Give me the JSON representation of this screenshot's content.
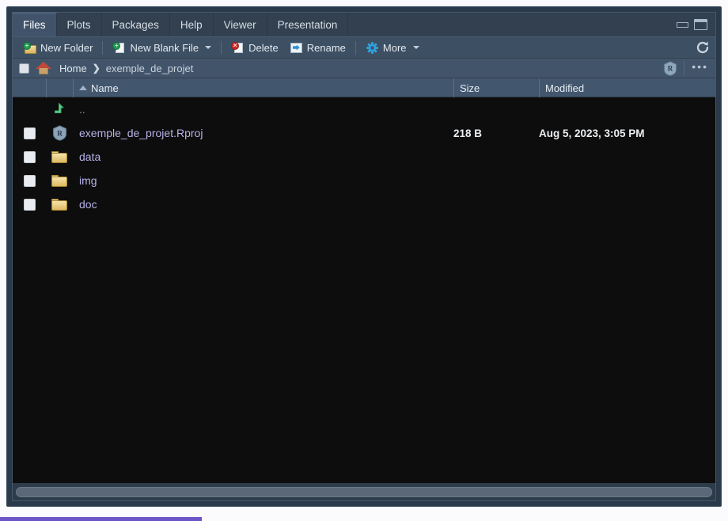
{
  "window": {
    "minimize_icon": "minimize-icon",
    "maximize_icon": "maximize-icon"
  },
  "tabs": [
    {
      "label": "Files",
      "active": true
    },
    {
      "label": "Plots",
      "active": false
    },
    {
      "label": "Packages",
      "active": false
    },
    {
      "label": "Help",
      "active": false
    },
    {
      "label": "Viewer",
      "active": false
    },
    {
      "label": "Presentation",
      "active": false
    }
  ],
  "toolbar": {
    "new_folder": "New Folder",
    "new_blank_file": "New Blank File",
    "delete": "Delete",
    "rename": "Rename",
    "more": "More",
    "refresh_icon": "refresh-icon"
  },
  "breadcrumb": {
    "home": "Home",
    "separator": "❯",
    "current": "exemple_de_projet",
    "project_badge_icon": "r-project-icon",
    "overflow": "•••"
  },
  "columns": {
    "name": "Name",
    "size": "Size",
    "modified": "Modified",
    "sort_direction": "ascending"
  },
  "files": [
    {
      "name": "..",
      "icon": "up-arrow-icon",
      "size": "",
      "modified": "",
      "checkbox": false,
      "link": false
    },
    {
      "name": "exemple_de_projet.Rproj",
      "icon": "r-project-icon",
      "size": "218 B",
      "modified": "Aug 5, 2023, 3:05 PM",
      "checkbox": true,
      "link": true
    },
    {
      "name": "data",
      "icon": "folder-icon",
      "size": "",
      "modified": "",
      "checkbox": true,
      "link": true
    },
    {
      "name": "img",
      "icon": "folder-icon",
      "size": "",
      "modified": "",
      "checkbox": true,
      "link": true
    },
    {
      "name": "doc",
      "icon": "folder-icon",
      "size": "",
      "modified": "",
      "checkbox": true,
      "link": true
    }
  ],
  "colors": {
    "link": "#b7b2e8",
    "accent": "#6d55c9",
    "panel": "#3b4d60",
    "list_bg": "#0d0d0d"
  }
}
